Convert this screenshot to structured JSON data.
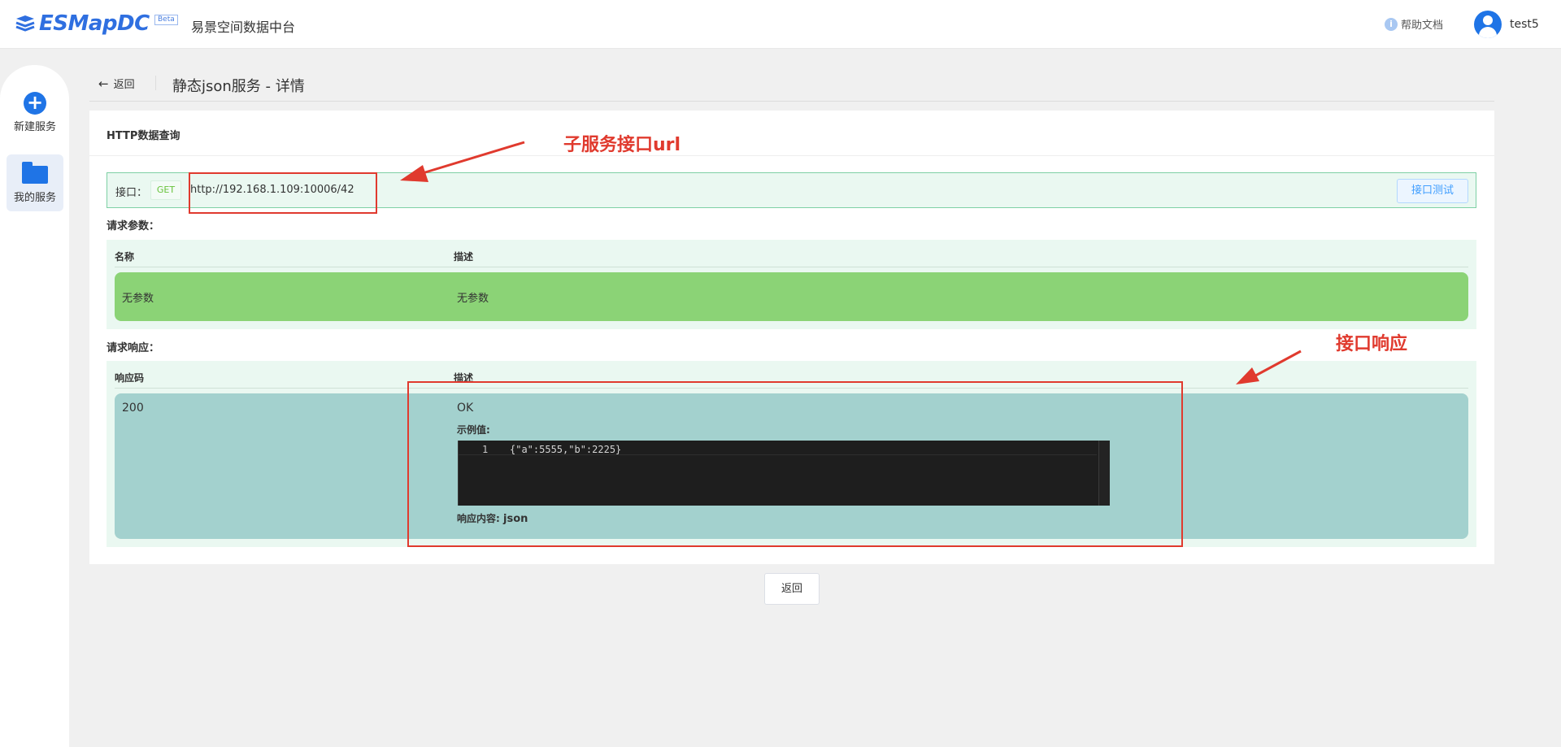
{
  "header": {
    "logo_text": "ESMapDC",
    "beta": "Beta",
    "brand_cn": "易景空间数据中台",
    "help_label": "帮助文档",
    "username": "test5"
  },
  "sidebar": {
    "items": [
      {
        "label": "新建服务",
        "icon": "plus-circle-icon"
      },
      {
        "label": "我的服务",
        "icon": "folder-icon"
      }
    ]
  },
  "breadcrumb": {
    "back_label": "返回",
    "title": "静态json服务 - 详情"
  },
  "card": {
    "title": "HTTP数据查询",
    "api": {
      "label": "接口：",
      "method": "GET",
      "url": "http://192.168.1.109:10006/42",
      "test_button": "接口测试"
    },
    "params": {
      "section_label": "请求参数：",
      "headers": [
        "名称",
        "描述"
      ],
      "rows": [
        {
          "name": "无参数",
          "desc": "无参数"
        }
      ]
    },
    "response": {
      "section_label": "请求响应：",
      "headers": [
        "响应码",
        "描述"
      ],
      "rows": [
        {
          "code": "200",
          "desc": "OK",
          "example_label": "示例值:",
          "example_line_no": "1",
          "example_code": "{\"a\":5555,\"b\":2225}",
          "content_label": "响应内容:",
          "content_type": "json"
        }
      ]
    }
  },
  "bottom_button": "返回",
  "annotations": {
    "url_note": "子服务接口url",
    "response_note": "接口响应",
    "color": "#e03a2e"
  },
  "colors": {
    "accent": "#1f74e6",
    "params_row": "#8bd376",
    "response_row": "#a3d1ce",
    "panel_bg": "#eaf8f1"
  }
}
